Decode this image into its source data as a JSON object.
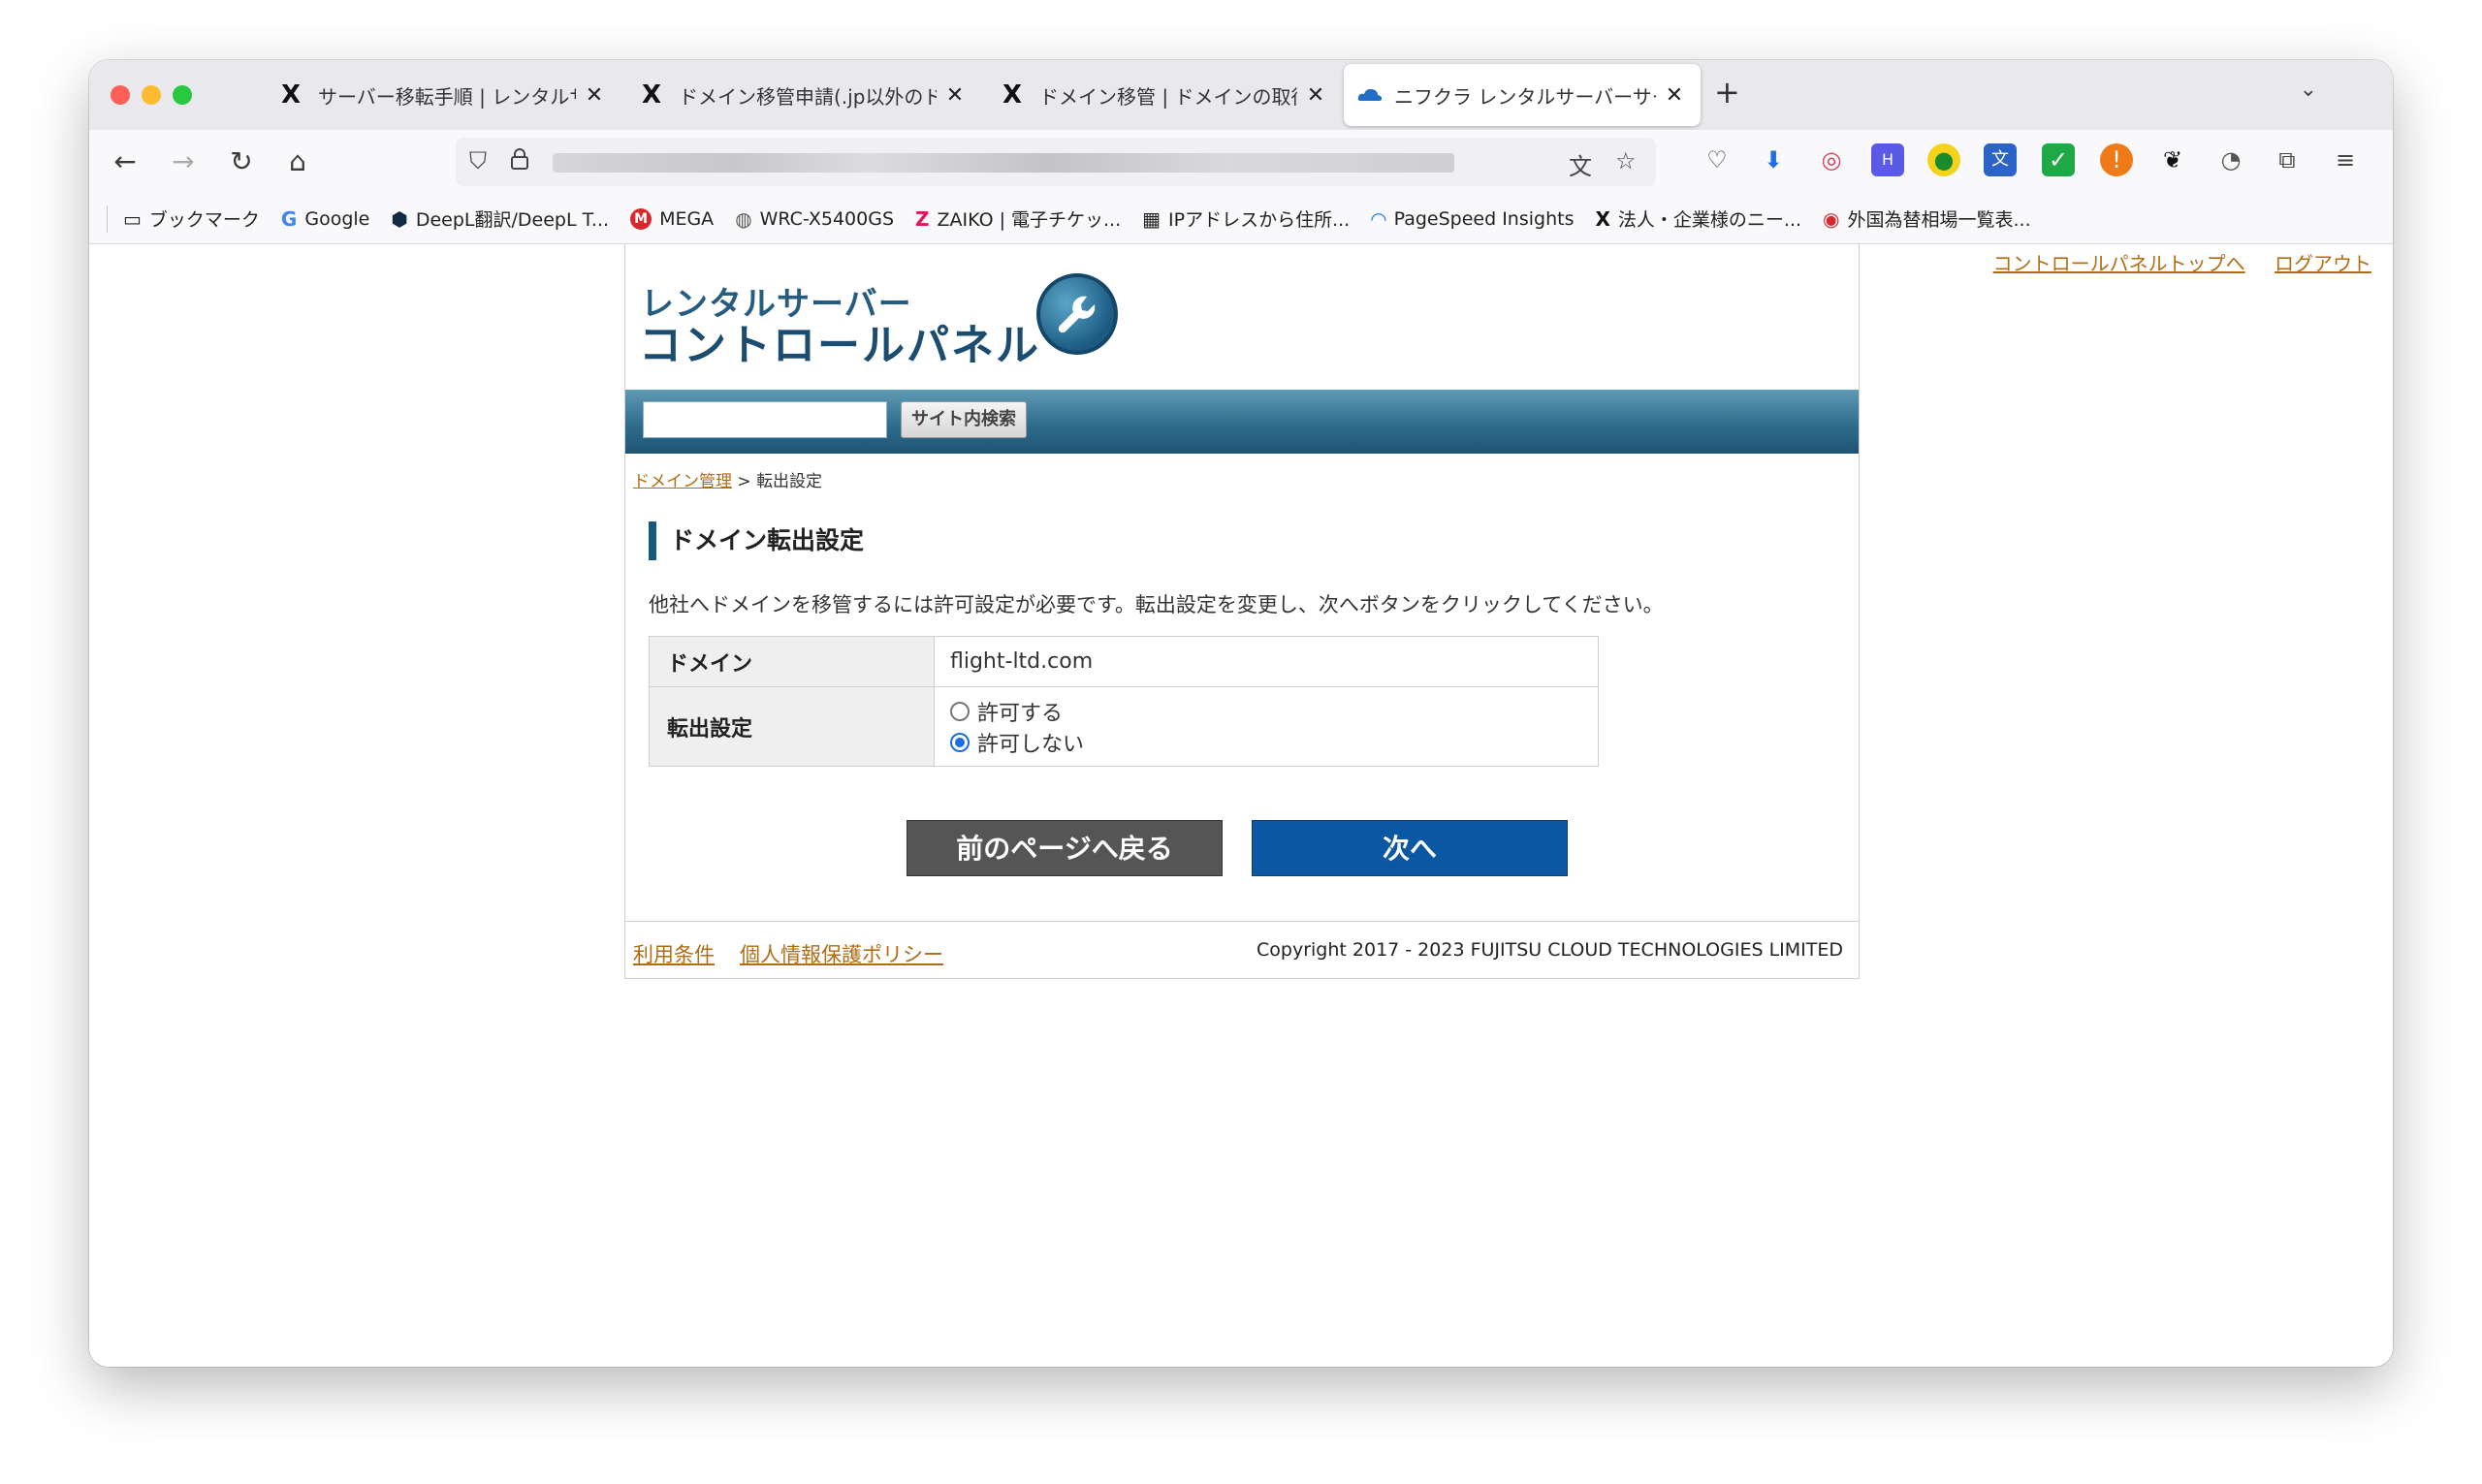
{
  "browser": {
    "tabs": [
      {
        "favicon": "X",
        "title": "サーバー移転手順 | レンタルサーバ",
        "active": false
      },
      {
        "favicon": "X",
        "title": "ドメイン移管申請(.jp以外のドメ",
        "active": false
      },
      {
        "favicon": "X",
        "title": "ドメイン移管 | ドメインの取得も",
        "active": false
      },
      {
        "favicon": "cloud",
        "title": "ニフクラ レンタルサーバーサービ",
        "active": true
      }
    ],
    "new_tab": "+",
    "tab_list": "⌄",
    "close_glyph": "✕"
  },
  "bookmarks": [
    {
      "icon": "folder",
      "label": "ブックマーク"
    },
    {
      "icon": "google",
      "label": "Google"
    },
    {
      "icon": "deepl",
      "label": "DeepL翻訳/DeepL T..."
    },
    {
      "icon": "mega",
      "label": "MEGA"
    },
    {
      "icon": "globe",
      "label": "WRC-X5400GS"
    },
    {
      "icon": "zaiko",
      "label": "ZAIKO | 電子チケッ..."
    },
    {
      "icon": "clapper",
      "label": "IPアドレスから住所..."
    },
    {
      "icon": "pagespeed",
      "label": "PageSpeed Insights"
    },
    {
      "icon": "x",
      "label": "法人・企業様のニー..."
    },
    {
      "icon": "mufg",
      "label": "外国為替相場一覧表..."
    }
  ],
  "page": {
    "top_links": [
      "コントロールパネルトップへ",
      "ログアウト"
    ],
    "logo_top": "レンタルサーバー",
    "logo_main": "コントロールパネル",
    "search_button": "サイト内検索",
    "breadcrumb": {
      "link": "ドメイン管理",
      "separator": ">",
      "current": "転出設定"
    },
    "title": "ドメイン転出設定",
    "description": "他社へドメインを移管するには許可設定が必要です。転出設定を変更し、次へボタンをクリックしてください。",
    "form": {
      "domain_label": "ドメイン",
      "domain_value": "flight-ltd.com",
      "transfer_label": "転出設定",
      "options": [
        {
          "label": "許可する",
          "selected": false
        },
        {
          "label": "許可しない",
          "selected": true
        }
      ]
    },
    "back_button": "前のページへ戻る",
    "next_button": "次へ",
    "footer": {
      "terms": "利用条件",
      "privacy": "個人情報保護ポリシー",
      "copyright": "Copyright 2017 - 2023 FUJITSU CLOUD TECHNOLOGIES LIMITED"
    }
  }
}
